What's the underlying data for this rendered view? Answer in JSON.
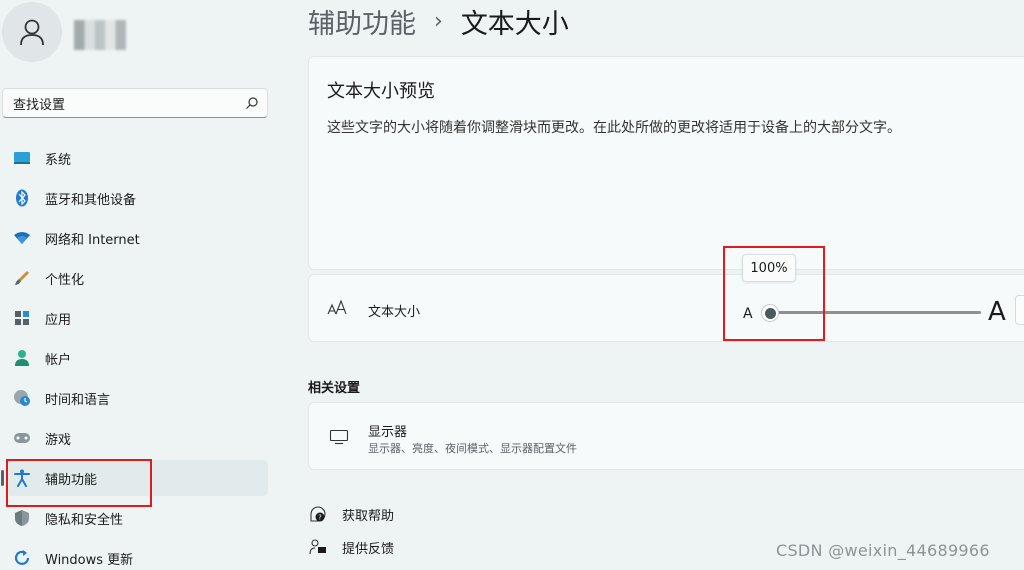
{
  "user": {
    "avatar_icon": "person-icon"
  },
  "search": {
    "placeholder": "查找设置",
    "icon": "search-icon"
  },
  "sidebar": {
    "items": [
      {
        "label": "系统",
        "icon": "monitor-icon"
      },
      {
        "label": "蓝牙和其他设备",
        "icon": "bluetooth-icon"
      },
      {
        "label": "网络和 Internet",
        "icon": "wifi-icon"
      },
      {
        "label": "个性化",
        "icon": "brush-icon"
      },
      {
        "label": "应用",
        "icon": "apps-icon"
      },
      {
        "label": "帐户",
        "icon": "account-icon"
      },
      {
        "label": "时间和语言",
        "icon": "clock-globe-icon"
      },
      {
        "label": "游戏",
        "icon": "gamepad-icon"
      },
      {
        "label": "辅助功能",
        "icon": "accessibility-icon",
        "active": true
      },
      {
        "label": "隐私和安全性",
        "icon": "shield-icon"
      },
      {
        "label": "Windows 更新",
        "icon": "update-icon"
      }
    ]
  },
  "breadcrumb": {
    "parent": "辅助功能",
    "separator": "›",
    "current": "文本大小"
  },
  "preview": {
    "title": "文本大小预览",
    "description": "这些文字的大小将随着你调整滑块而更改。在此处所做的更改将适用于设备上的大部分文字。"
  },
  "text_size": {
    "label": "文本大小",
    "small_a": "A",
    "big_a": "A",
    "tooltip": "100%",
    "value_percent": 100
  },
  "related": {
    "title": "相关设置",
    "display": {
      "title": "显示器",
      "subtitle": "显示器、亮度、夜间模式、显示器配置文件"
    }
  },
  "links": {
    "help": "获取帮助",
    "feedback": "提供反馈"
  },
  "watermark": "CSDN @weixin_44689966",
  "colors": {
    "accent": "#0067c0",
    "highlight_box": "#e01b1b",
    "background": "#eef4f4"
  }
}
